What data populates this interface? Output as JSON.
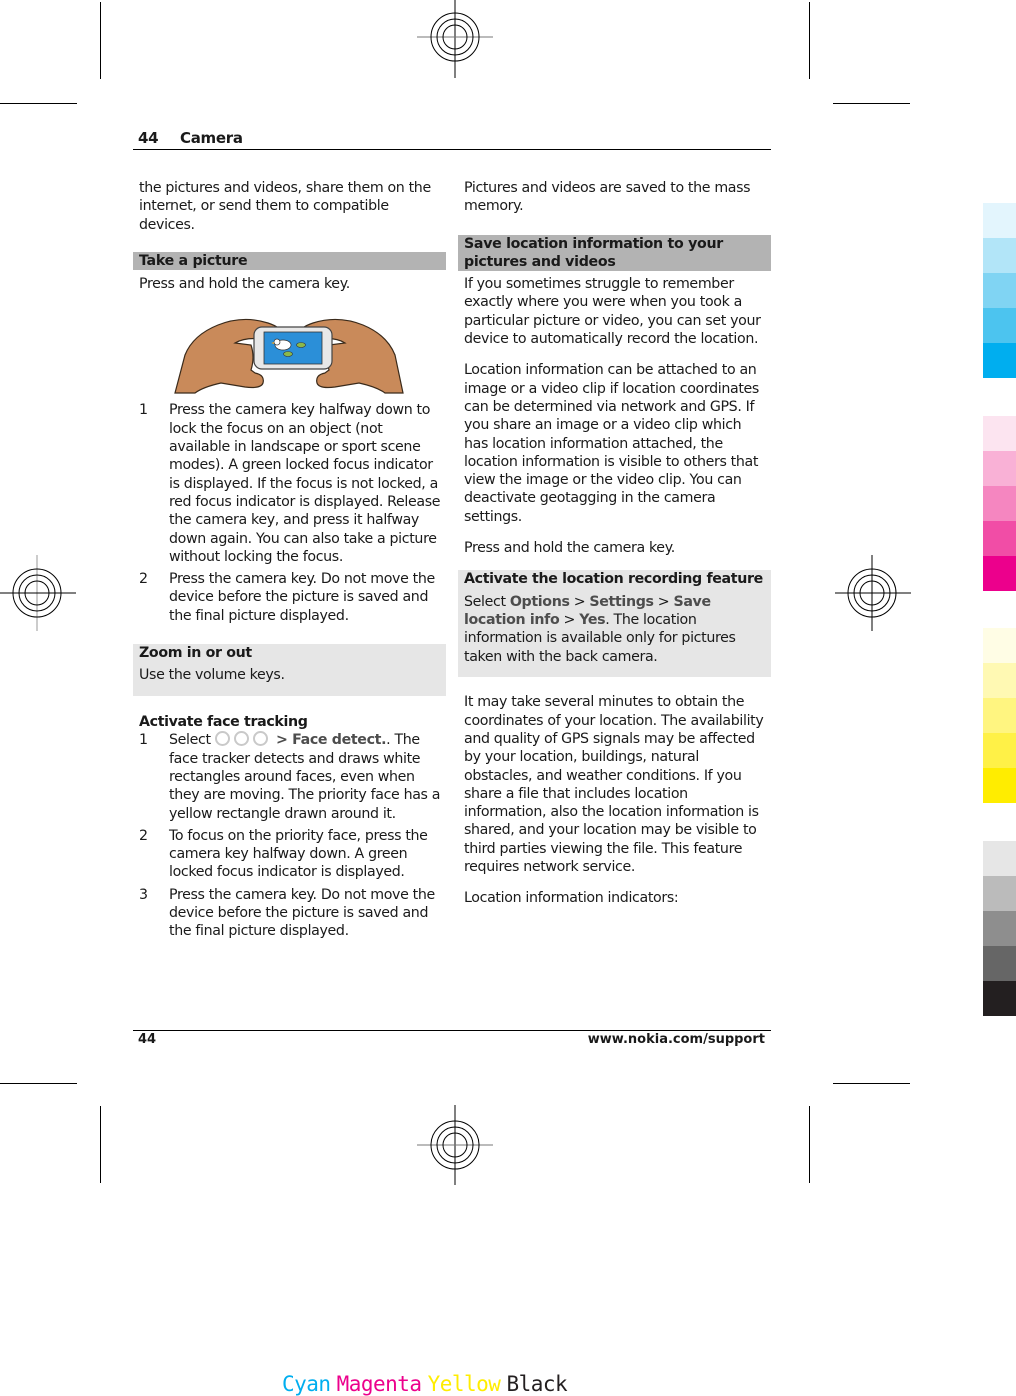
{
  "header": {
    "page_number": "44",
    "section": "Camera"
  },
  "footer": {
    "page_number": "44",
    "url": "www.nokia.com/support"
  },
  "left_column": {
    "intro": "the pictures and videos, share them on the internet, or send them to compatible devices.",
    "take_picture": {
      "heading": "Take a picture",
      "text": "Press and hold the camera key.",
      "illustration": "hands-holding-phone-camera-illustration",
      "steps": [
        {
          "num": "1",
          "text": "Press the camera key halfway down to lock the focus on an object (not available in landscape or sport scene modes). A green locked focus indicator is displayed. If the focus is not locked, a red focus indicator is displayed. Release the camera key, and press it halfway down again. You can also take a picture without locking the focus."
        },
        {
          "num": "2",
          "text": "Press the camera key. Do not move the device before the picture is saved and the final picture displayed."
        }
      ]
    },
    "zoom": {
      "heading": "Zoom in or out",
      "text": "Use the volume keys."
    },
    "face_tracking": {
      "heading": "Activate face tracking",
      "steps": [
        {
          "num": "1",
          "pre": "Select",
          "icons": [
            "menu-icon",
            "menu-icon",
            "menu-icon"
          ],
          "ui": "> Face detect.",
          "post": ". The face tracker detects and draws white rectangles around faces, even when they are moving. The priority face has a yellow rectangle drawn around it."
        },
        {
          "num": "2",
          "text": "To focus on the priority face, press the camera key halfway down. A green locked focus indicator is displayed."
        },
        {
          "num": "3",
          "text": "Press the camera key. Do not move the device before the picture is saved and the final picture displayed."
        }
      ]
    }
  },
  "right_column": {
    "intro": "Pictures and videos are saved to the mass memory.",
    "save_location": {
      "heading": "Save location information to your pictures and videos",
      "p1": "If you sometimes struggle to remember exactly where you were when you took a particular picture or video, you can set your device to automatically record the location.",
      "p2": "Location information can be attached to an image or a video clip if location coordinates can be determined via network and GPS. If you share an image or a video clip which has location information attached, the location information is visible to others that view the image or the video clip. You can deactivate geotagging in the camera settings.",
      "p3": "Press and hold the camera key."
    },
    "activate_location": {
      "heading": "Activate the location recording feature",
      "select": "Select",
      "ui1": "Options",
      "sep1": " > ",
      "ui2": "Settings",
      "sep2": " > ",
      "ui3": "Save location info",
      "sep3": " > ",
      "ui4": "Yes",
      "post": ". The location information is available only for pictures taken with the back camera."
    },
    "p4": "It may take several minutes to obtain the coordinates of your location. The availability and quality of GPS signals may be affected by your location, buildings, natural obstacles, and weather conditions. If you share a file that includes location information, also the location information is shared, and your location may be visible to third parties viewing the file. This feature requires network service.",
    "p5": "Location information indicators:"
  },
  "print_marks": {
    "color_bars": {
      "cyan": [
        "#e3f5fd",
        "#b2e5f8",
        "#80d4f3",
        "#4cc4ef",
        "#00aeef"
      ],
      "magenta": [
        "#fce4f0",
        "#f9b1d6",
        "#f586c0",
        "#f14da6",
        "#ec008c"
      ],
      "yellow": [
        "#fffde5",
        "#fff9b3",
        "#fff580",
        "#fff147",
        "#ffed00"
      ],
      "black": [
        "#e6e6e6",
        "#bbbbbb",
        "#8e8e8e",
        "#666666",
        "#231f20"
      ]
    },
    "separation_labels": [
      {
        "text": "Cyan",
        "color": "#00aeef"
      },
      {
        "text": "Magenta",
        "color": "#ec008c"
      },
      {
        "text": "Yellow",
        "color": "#ffed00"
      },
      {
        "text": "Black",
        "color": "#231f20"
      }
    ]
  }
}
